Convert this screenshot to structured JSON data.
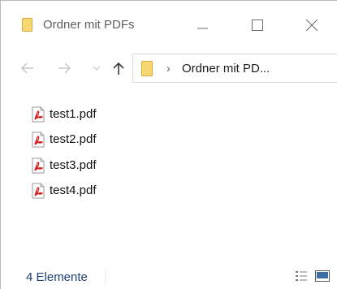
{
  "window": {
    "title": "Ordner mit PDFs"
  },
  "address": {
    "path_label": "Ordner mit PD..."
  },
  "files": [
    {
      "name": "test1.pdf"
    },
    {
      "name": "test2.pdf"
    },
    {
      "name": "test3.pdf"
    },
    {
      "name": "test4.pdf"
    }
  ],
  "status": {
    "item_count": "4 Elemente"
  },
  "icons": {
    "title_folder": "folder-icon",
    "address_folder": "folder-icon",
    "file": "pdf-file-icon",
    "view_details": "details-view-icon",
    "view_tiles": "large-icons-view-icon"
  },
  "colors": {
    "folder_yellow": "#f8d775",
    "pdf_red": "#d61f1f",
    "status_blue": "#1f3f74"
  }
}
